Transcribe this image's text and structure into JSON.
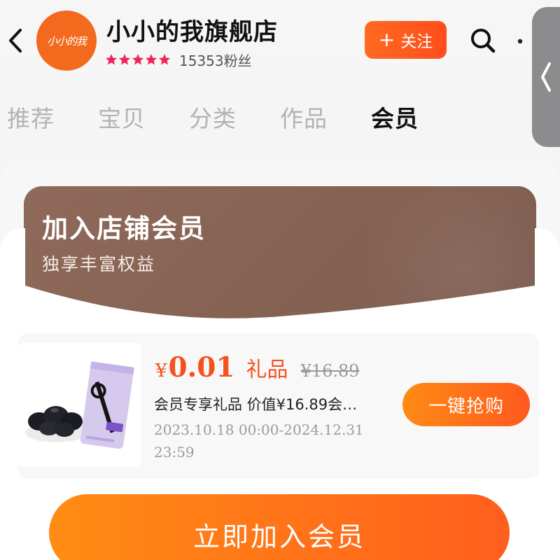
{
  "header": {
    "back_icon": "chevron-left-icon",
    "logo_text": "小小的我",
    "logo_color": "#f36a1f",
    "shop_name": "小小的我旗舰店",
    "rating_stars": 5,
    "fans_label": "15353粉丝",
    "follow_label": "关注",
    "follow_icon": "plus-icon",
    "search_icon": "search-icon",
    "more_icon": "more-dots-icon",
    "side_handle_icon": "chevron-left-icon"
  },
  "tabs": [
    {
      "label": "推荐",
      "active": false
    },
    {
      "label": "宝贝",
      "active": false
    },
    {
      "label": "分类",
      "active": false
    },
    {
      "label": "作品",
      "active": false
    },
    {
      "label": "会员",
      "active": true
    }
  ],
  "banner": {
    "title": "加入店铺会员",
    "subtitle": "独享丰富权益",
    "color": "#876353"
  },
  "product": {
    "image_alt": "product-image",
    "currency": "¥",
    "price": "0.01",
    "gift_label": "礼品",
    "original_price": "¥16.89",
    "description": "会员专享礼品 价值¥16.89会…",
    "period": "2023.10.18 00:00-2024.12.31 23:59",
    "button_label": "一键抢购"
  },
  "cta": {
    "label": "立即加入会员",
    "color": "#ff6a1a"
  },
  "colors": {
    "accent": "#f4511e",
    "muted": "#9b9b9b"
  }
}
